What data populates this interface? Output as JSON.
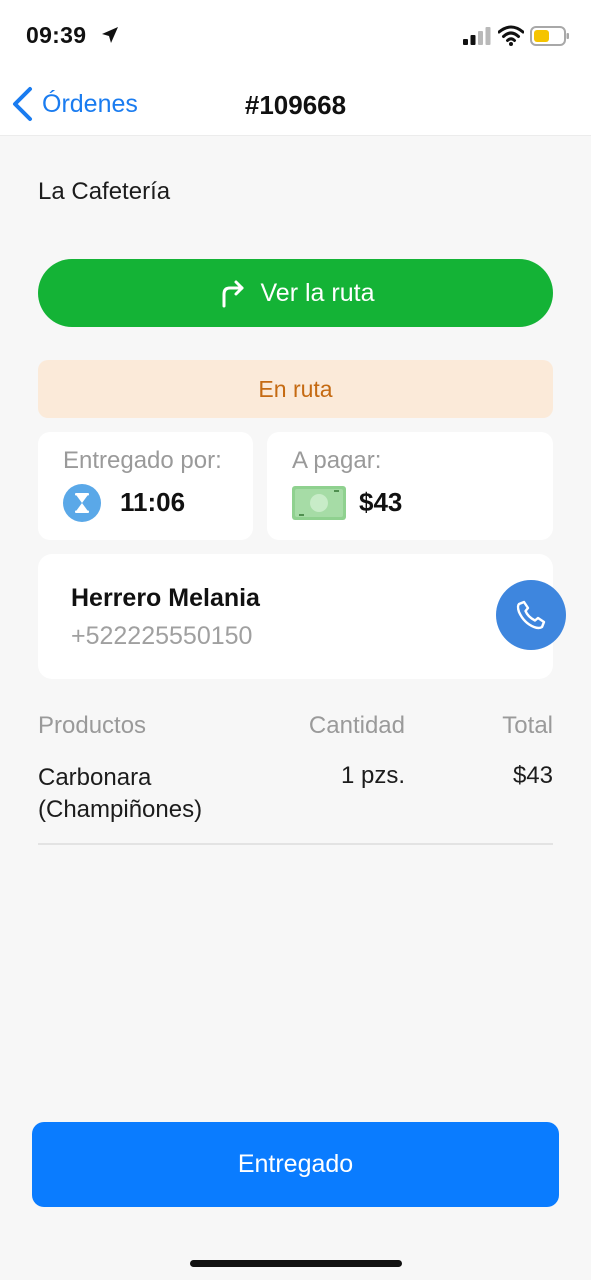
{
  "status_bar": {
    "time": "09:39",
    "icons": [
      "location-arrow-icon",
      "signal-icon",
      "wifi-icon",
      "battery-icon"
    ],
    "battery_color": "#f5c400",
    "signal_bars_filled": 2,
    "signal_bars_total": 4
  },
  "nav": {
    "back_label": "Órdenes",
    "title": "#109668",
    "accent_color": "#1a7cf0"
  },
  "order": {
    "store_name": "La Cafetería",
    "route_button_label": "Ver la ruta",
    "status_label": "En ruta",
    "delivery": {
      "label": "Entregado por:",
      "time": "11:06",
      "icon": "hourglass-icon"
    },
    "payment": {
      "label": "A pagar:",
      "amount": "$43",
      "icon": "cash-icon"
    },
    "customer": {
      "name": "Herrero Melania",
      "phone": "+522225550150"
    }
  },
  "products": {
    "headers": {
      "product": "Productos",
      "quantity": "Cantidad",
      "total": "Total"
    },
    "items": [
      {
        "name": "Carbonara (Champiñones)",
        "quantity": "1 pzs.",
        "total": "$43"
      }
    ]
  },
  "actions": {
    "deliver_label": "Entregado"
  },
  "colors": {
    "route_button": "#14b336",
    "status_banner_bg": "#fbead9",
    "status_banner_text": "#c56a12",
    "call_button": "#3e86de",
    "deliver_button": "#0a7cff"
  }
}
